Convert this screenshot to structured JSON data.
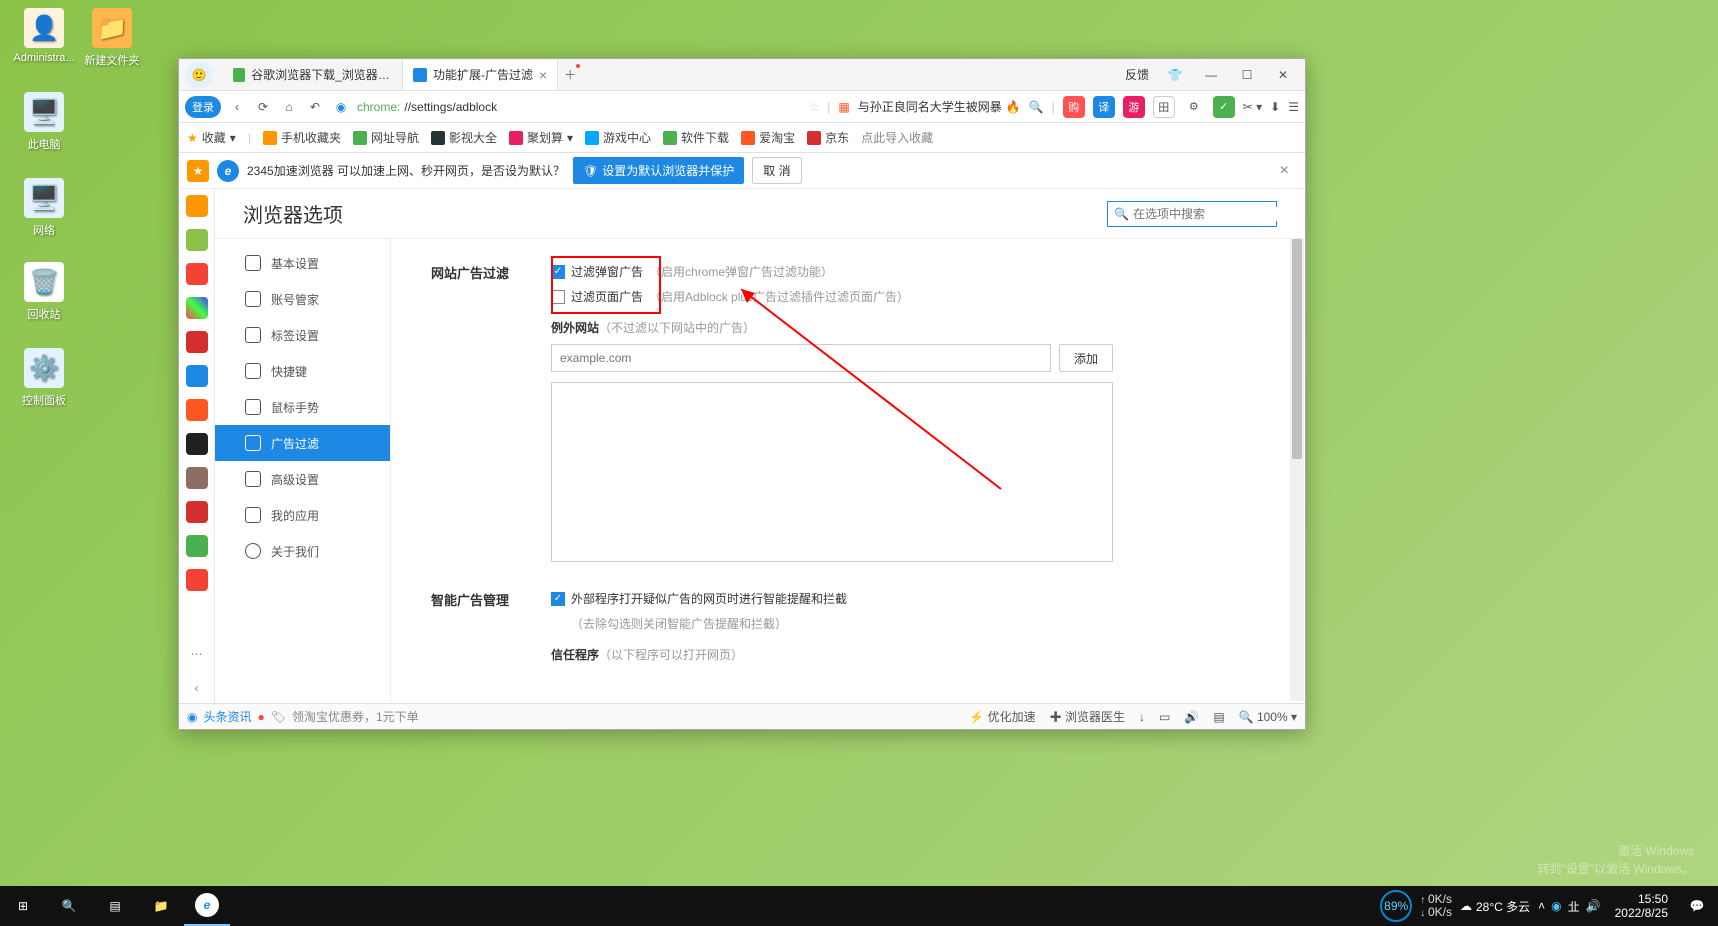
{
  "desktop": {
    "icons": [
      {
        "label": "Administra..."
      },
      {
        "label": "新建文件夹"
      },
      {
        "label": "此电脑"
      },
      {
        "label": "网络"
      },
      {
        "label": "回收站"
      },
      {
        "label": "控制面板"
      }
    ]
  },
  "browser": {
    "tabs": [
      {
        "title": "谷歌浏览器下载_浏览器官网入"
      },
      {
        "title": "功能扩展-广告过滤",
        "active": true
      }
    ],
    "feedback": "反馈",
    "login": "登录",
    "address": {
      "scheme": "chrome:",
      "path": "//settings/adblock"
    },
    "news": "与孙正良同名大学生被网暴",
    "toolbar_icons": [
      "购",
      "译",
      "游",
      "田",
      "⚙",
      "绿"
    ],
    "bookmarks": {
      "fav": "收藏",
      "items": [
        "手机收藏夹",
        "网址导航",
        "影视大全",
        "聚划算",
        "游戏中心",
        "软件下载",
        "爱淘宝",
        "京东",
        "点此导入收藏"
      ]
    },
    "banner": {
      "text": "2345加速浏览器 可以加速上网、秒开网页，是否设为默认？",
      "primary": "设置为默认浏览器并保护",
      "cancel": "取 消"
    }
  },
  "settings": {
    "title": "浏览器选项",
    "search_placeholder": "在选项中搜索",
    "nav": [
      "基本设置",
      "账号管家",
      "标签设置",
      "快捷键",
      "鼠标手势",
      "广告过滤",
      "高级设置",
      "我的应用",
      "关于我们"
    ],
    "section1": {
      "label": "网站广告过滤",
      "opt1": {
        "label": "过滤弹窗广告",
        "hint": "（启用chrome弹窗广告过滤功能）"
      },
      "opt2": {
        "label": "过滤页面广告",
        "hint": "（启用Adblock plus广告过滤插件过滤页面广告）"
      },
      "exception_title": "例外网站",
      "exception_hint": "（不过滤以下网站中的广告）",
      "input_placeholder": "example.com",
      "add_btn": "添加"
    },
    "section2": {
      "label": "智能广告管理",
      "opt1": {
        "label": "外部程序打开疑似广告的网页时进行智能提醒和拦截",
        "hint": "（去除勾选则关闭智能广告提醒和拦截）"
      },
      "trust_title": "信任程序",
      "trust_hint": "（以下程序可以打开网页）"
    }
  },
  "statusbar": {
    "news": "头条资讯",
    "coupon": "领淘宝优惠券，1元下单",
    "optimize": "优化加速",
    "doctor": "浏览器医生",
    "zoom": "100%"
  },
  "taskbar": {
    "perf": "89%",
    "up": "0K/s",
    "down": "0K/s",
    "weather": "28°C 多云",
    "time": "15:50",
    "date": "2022/8/25"
  },
  "watermark": {
    "l1": "激活 Windows",
    "l2": "转到\"设置\"以激活 Windows。"
  }
}
